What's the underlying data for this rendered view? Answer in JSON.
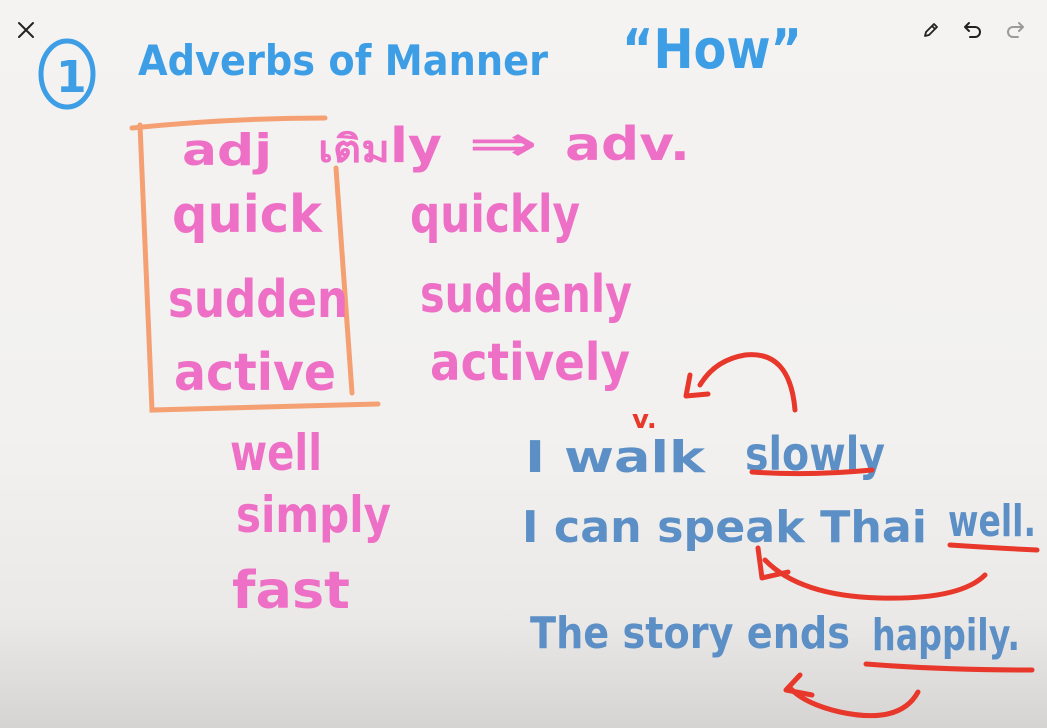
{
  "toolbar": {
    "close_icon": "close-icon",
    "pencil_icon": "pencil-icon",
    "undo_icon": "undo-icon",
    "redo_icon": "redo-icon"
  },
  "colors": {
    "blue_heading": "#3d9ee6",
    "pink_words": "#ee6fc6",
    "slate_sentences": "#5b8fc6",
    "orange_box": "#f4a072",
    "red_marks": "#e8382b"
  },
  "heading": {
    "number": "1",
    "title": "Adverbs of Manner",
    "question": "“How”"
  },
  "rule": {
    "adj": "adj",
    "thai_add": "เติม",
    "ly": "ly",
    "arrow": "⇒",
    "adv": "adv."
  },
  "adjectives": [
    "quick",
    "sudden",
    "active"
  ],
  "adverbs": [
    "quickly",
    "suddenly",
    "actively"
  ],
  "irregular": [
    "well",
    "simply",
    "fast"
  ],
  "verb_mark": "v.",
  "sentences": {
    "s1_pre": "I walk",
    "s1_adv": "slowly",
    "s2_pre": "I can speak Thai",
    "s2_adv": "well.",
    "s3_pre": "The story ends",
    "s3_adv": "happily."
  }
}
